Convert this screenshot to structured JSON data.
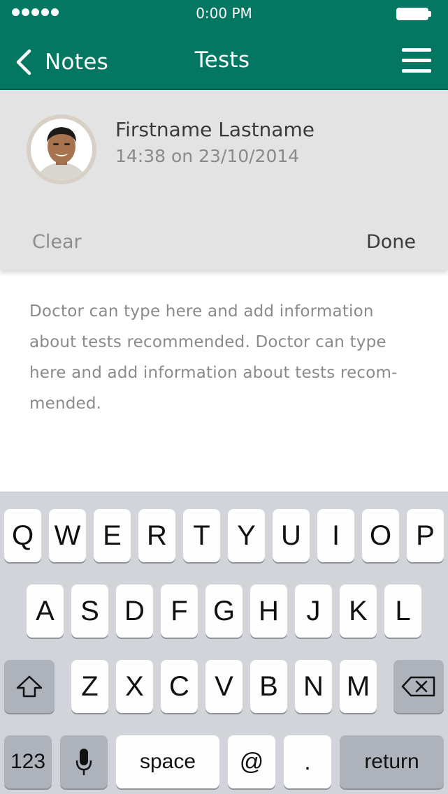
{
  "status_bar": {
    "time": "0:00 PM"
  },
  "nav": {
    "back_label": "Notes",
    "title": "Tests"
  },
  "profile": {
    "name": "Firstname Lastname",
    "timestamp": "14:38 on 23/10/2014",
    "clear_label": "Clear",
    "done_label": "Done"
  },
  "note": {
    "line1": "Doctor can type here and add information",
    "line2": "about tests recommended. Doctor can type",
    "line3": "here and add information about tests recom-",
    "line4": "mended."
  },
  "keyboard": {
    "row1": [
      "Q",
      "W",
      "E",
      "R",
      "T",
      "Y",
      "U",
      "I",
      "O",
      "P"
    ],
    "row2": [
      "A",
      "S",
      "D",
      "F",
      "G",
      "H",
      "J",
      "K",
      "L"
    ],
    "row3": [
      "Z",
      "X",
      "C",
      "V",
      "B",
      "N",
      "M"
    ],
    "numbers_label": "123",
    "space_label": "space",
    "at_label": "@",
    "period_label": ".",
    "return_label": "return",
    "icons": {
      "shift": "shift-icon",
      "delete": "backspace-icon",
      "mic": "microphone-icon"
    }
  },
  "colors": {
    "header": "#037762",
    "panel": "#e3e3e3",
    "keyboard": "#d1d4d8"
  }
}
